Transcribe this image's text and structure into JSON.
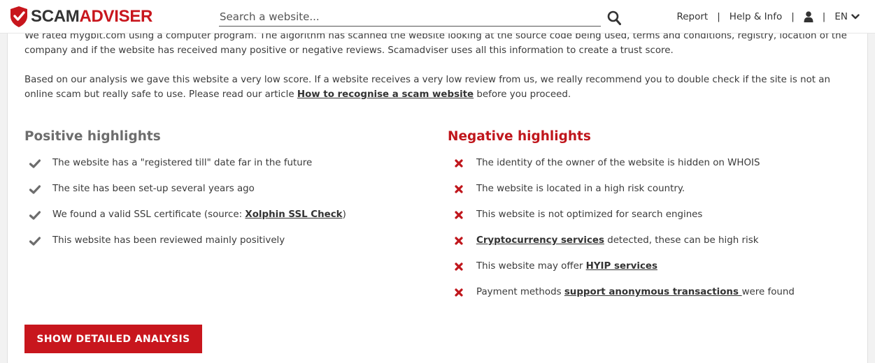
{
  "header": {
    "logo": {
      "text_dark": "SCAM",
      "text_red": "ADVISER",
      "icon": "shield-check-icon"
    },
    "search": {
      "placeholder": "Search a website...",
      "value": "",
      "icon": "search-icon"
    },
    "nav": {
      "report": "Report",
      "help": "Help & Info",
      "user_icon": "user-icon",
      "language": "EN",
      "separator": "|"
    }
  },
  "content": {
    "para1": "We rated mygbit.com using a computer program. The algorithm has scanned the website looking at the source code being used, terms and conditions, registry, location of the company and if the website has received many positive or negative reviews. Scamadviser uses all this information to create a trust score.",
    "para2": {
      "before": "Based on our analysis we gave this website a very low score. If a website receives a very low review from us, we really recommend you to double check if the site is not an online scam but really safe to use. Please read our article ",
      "link": "How to recognise a scam website",
      "after": " before you proceed."
    },
    "positive": {
      "title": "Positive highlights",
      "items": [
        {
          "text": "The website has a \"registered till\" date far in the future"
        },
        {
          "text": "The site has been set-up several years ago"
        },
        {
          "before": "We found a valid SSL certificate (source: ",
          "link": "Xolphin SSL Check",
          "after": ")"
        },
        {
          "text": "This website has been reviewed mainly positively"
        }
      ]
    },
    "negative": {
      "title": "Negative highlights",
      "items": [
        {
          "text": "The identity of the owner of the website is hidden on WHOIS"
        },
        {
          "text": "The website is located in a high risk country."
        },
        {
          "text": "This website is not optimized for search engines"
        },
        {
          "before": "",
          "link": "Cryptocurrency services",
          "after": " detected, these can be high risk"
        },
        {
          "before": "This website may offer ",
          "link": "HYIP services",
          "after": ""
        },
        {
          "before": "Payment methods ",
          "link": "support anonymous transactions ",
          "after": "were found"
        }
      ]
    },
    "cta_label": "SHOW DETAILED ANALYSIS"
  },
  "colors": {
    "brand_red": "#c8161d",
    "check_gray": "#6d6d6d",
    "text": "#3a3a3a"
  }
}
